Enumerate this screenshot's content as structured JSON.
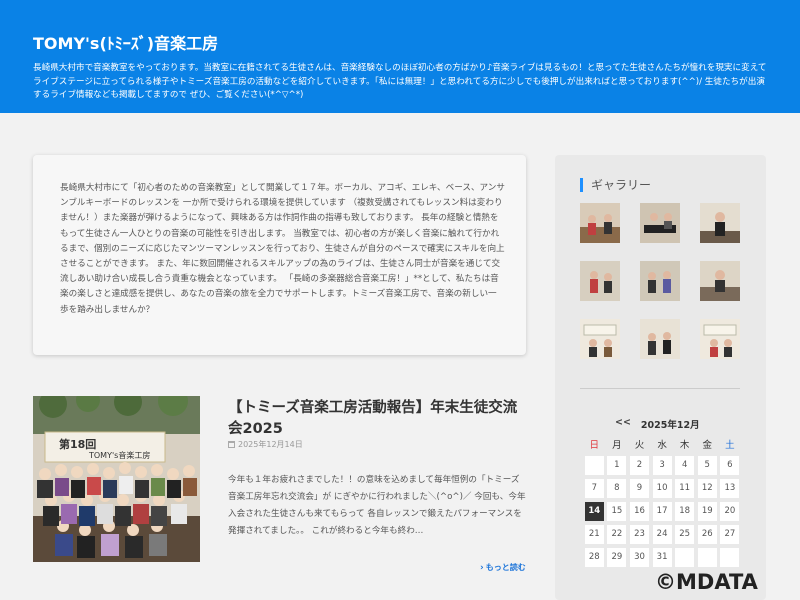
{
  "header": {
    "site_title": "TOMY's(ﾄﾐｰｽﾞ)音楽工房",
    "description": "長崎県大村市で音楽教室をやっております。当教室に在籍されてる生徒さんは、音楽経験なしのほぼ初心者の方ばかり♪音楽ライブは見るもの！と思ってた生徒さんたちが憧れを現実に変えてライブステージに立ってられる様子やトミーズ音楽工房の活動などを紹介していきます。「私には無理！」と思われてる方に少しでも後押しが出来ればと思っております(^^)/ 生徒たちが出演するライブ情報なども掲載してますので ぜひ、ご覧ください(*^▽^*)"
  },
  "intro": {
    "text": "長崎県大村市にて「初心者のための音楽教室」として開業して１７年。ボーカル、アコギ、エレキ、ベース、アンサンブルキーボードのレッスンを 一か所で受けられる環境を提供しています （複数受講されてもレッスン料は変わりません！）また楽器が弾けるようになって、興味ある方は作詞作曲の指導も致しております。 長年の経験と情熱をもって生徒さん一人ひとりの音楽の可能性を引き出します。 当教室では、初心者の方が楽しく音楽に触れて行かれるまで、個別のニーズに応じたマンツーマンレッスンを行っており、生徒さんが自分のペースで確実にスキルを向上させることができます。 また、年に数回開催されるスキルアップの為のライブは、生徒さん同士が音楽を通じて交流しあい助け合い成長し合う貴重な機会となっています。 「長崎の多楽器総合音楽工房！」**として、私たちは音楽の楽しさと達成感を提供し、あなたの音楽の旅を全力でサポートします。トミーズ音楽工房で、音楽の新しい一歩を踏み出しませんか？"
  },
  "post": {
    "title": "【トミーズ音楽工房活動報告】年末生徒交流会2025",
    "date": "2025年12月14日",
    "excerpt": "今年も１年お疲れさまでした！！の意味を込めまして毎年恒例の「トミーズ音楽工房年忘れ交流会」が にぎやかに行われました＼(^o^)／ 今回も、今年入会された生徒さんも来てもらって 各自レッスンで鍛えたパフォーマンスを発揮されてました。。 これが終わると今年も終わ…",
    "read_more": "もっと読む",
    "thumb_banner_text": "第18回",
    "thumb_banner_sub": "TOMY's音楽工房"
  },
  "sidebar": {
    "gallery_title": "ギャラリー",
    "calendar": {
      "prev": "<<",
      "month": "2025年12月",
      "weekdays": [
        "日",
        "月",
        "火",
        "水",
        "木",
        "金",
        "土"
      ],
      "weeks": [
        [
          "",
          "1",
          "2",
          "3",
          "4",
          "5",
          "6"
        ],
        [
          "7",
          "8",
          "9",
          "10",
          "11",
          "12",
          "13"
        ],
        [
          "14",
          "15",
          "16",
          "17",
          "18",
          "19",
          "20"
        ],
        [
          "21",
          "22",
          "23",
          "24",
          "25",
          "26",
          "27"
        ],
        [
          "28",
          "29",
          "30",
          "31",
          "",
          "",
          ""
        ]
      ],
      "today": "14"
    }
  },
  "watermark": "©MDATA",
  "colors": {
    "header_bg": "#0a82e6",
    "accent": "#1e90ff",
    "sunday": "#e0393e",
    "saturday": "#1e6fd9",
    "link": "#1a73d9"
  }
}
